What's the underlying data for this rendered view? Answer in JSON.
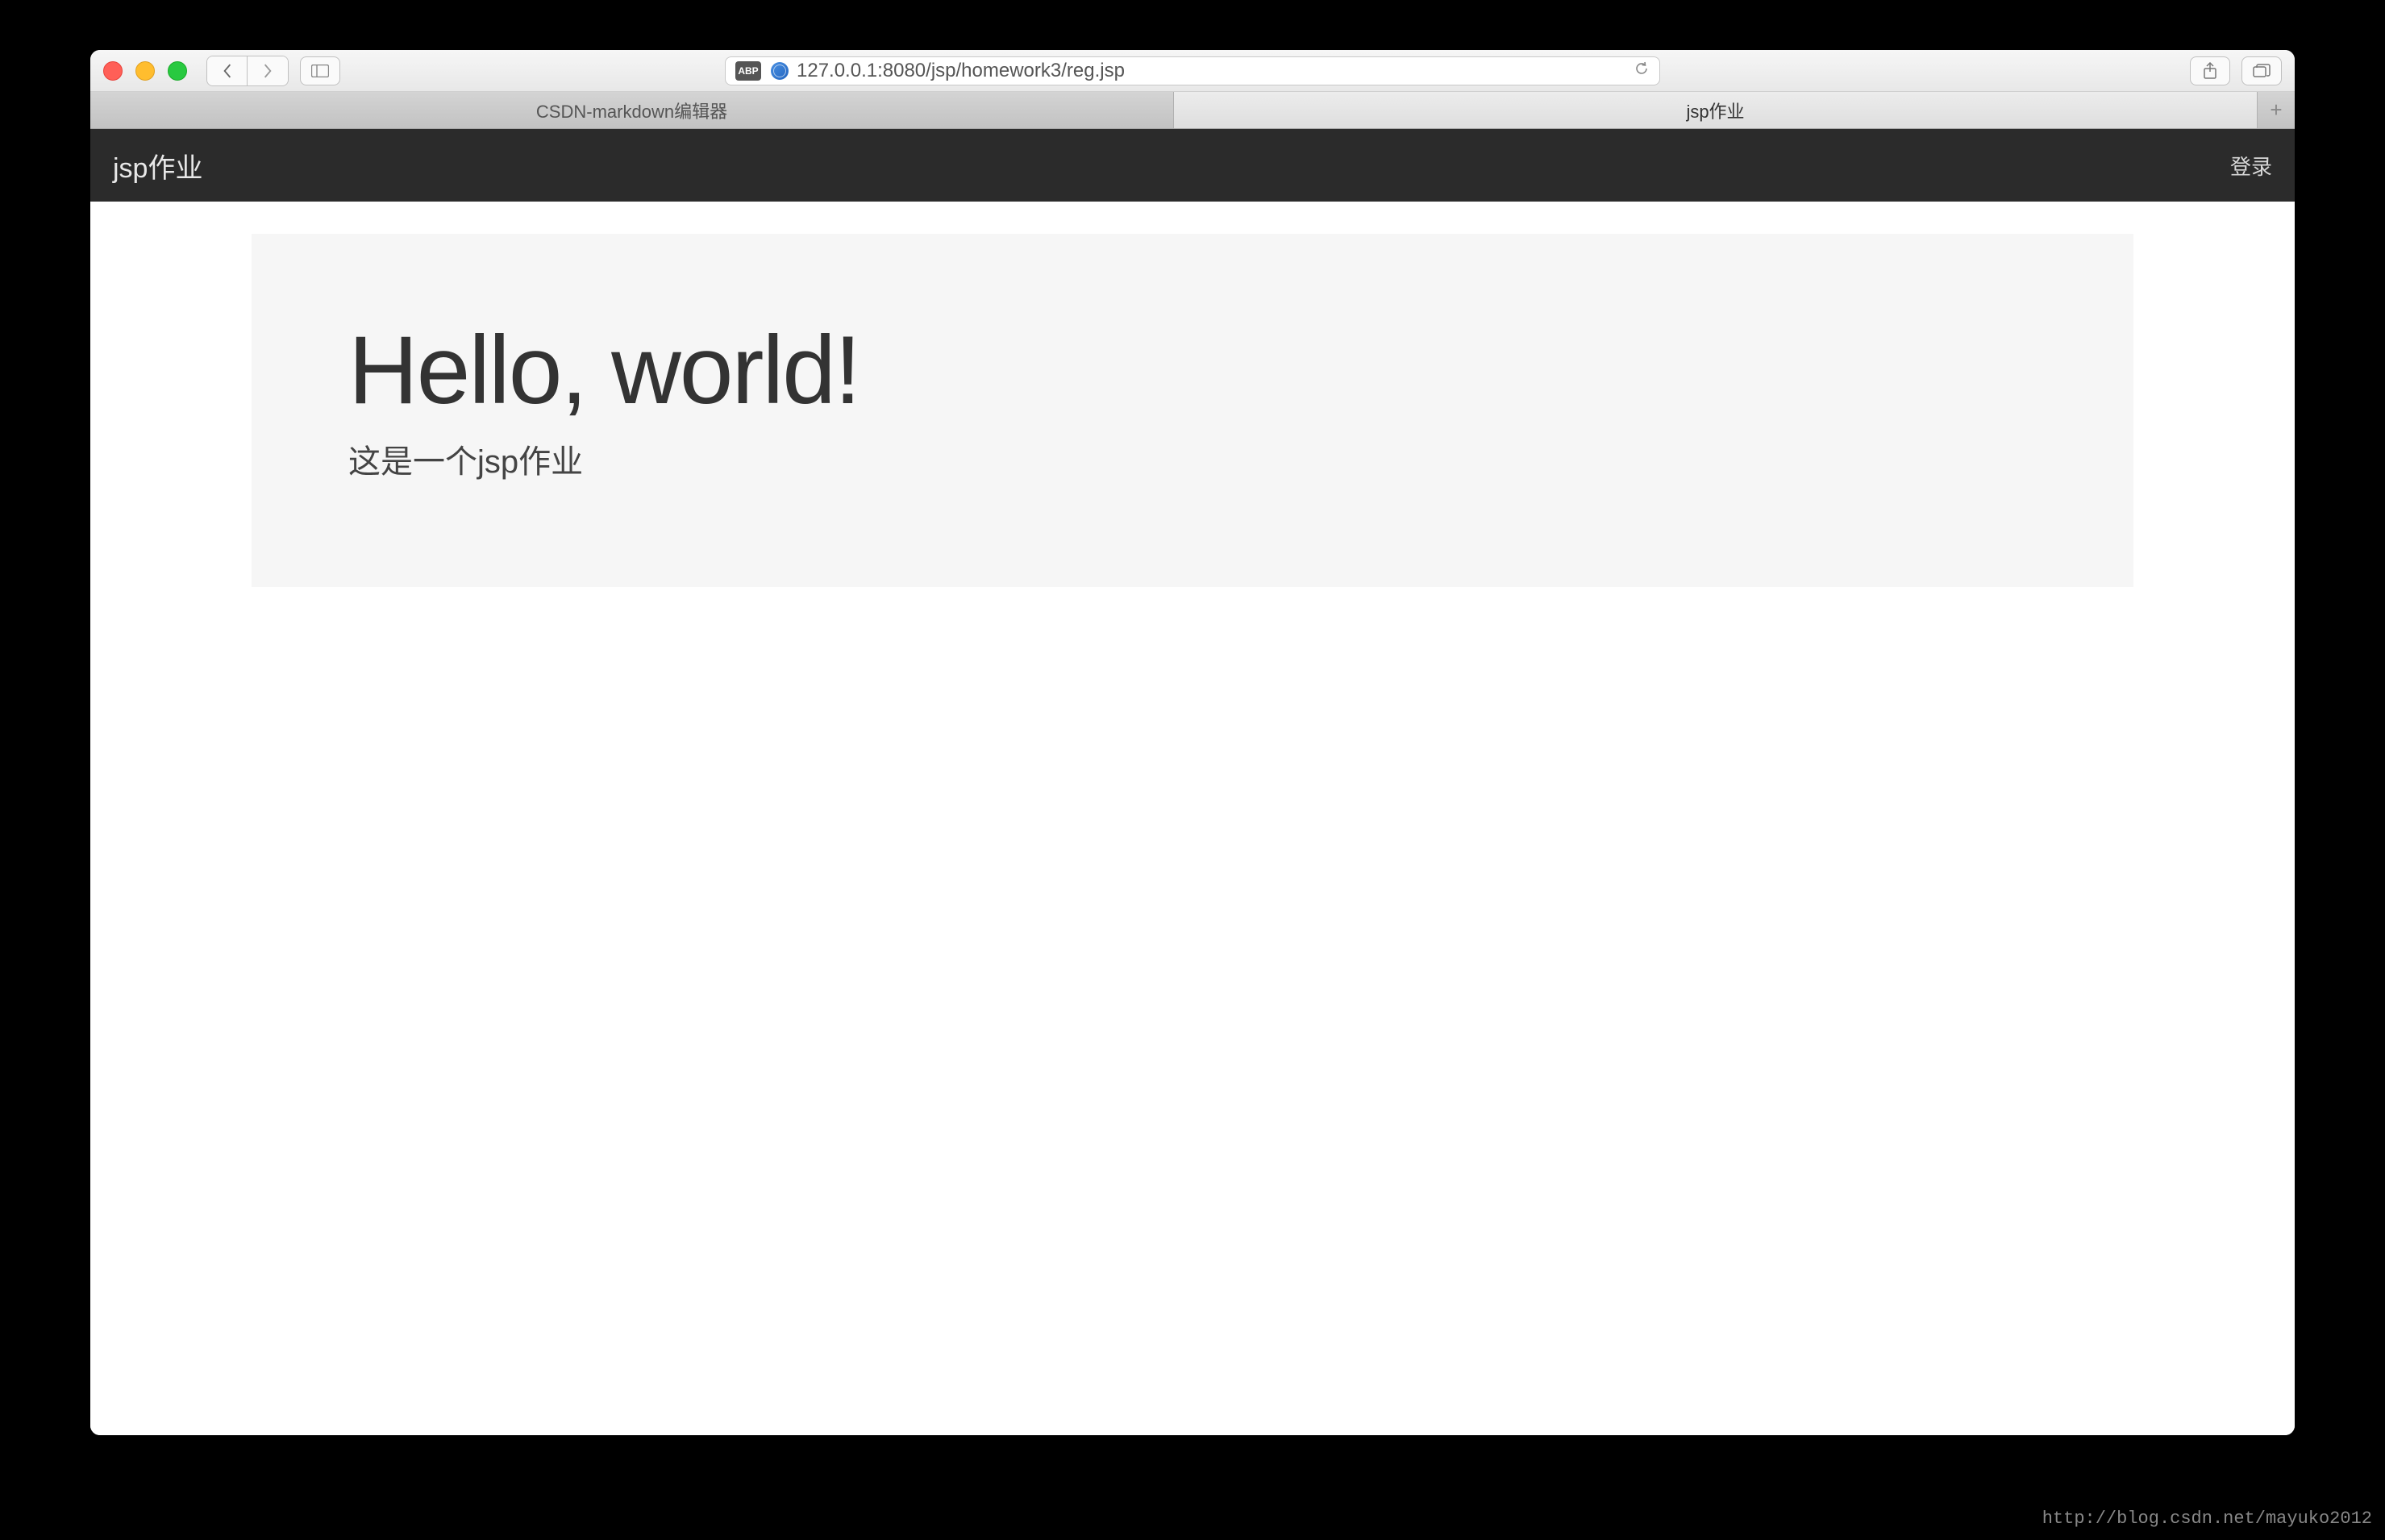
{
  "browser": {
    "url": "127.0.0.1:8080/jsp/homework3/reg.jsp",
    "abp_label": "ABP",
    "tabs": [
      {
        "label": "CSDN-markdown编辑器",
        "active": false
      },
      {
        "label": "jsp作业",
        "active": true
      }
    ]
  },
  "page": {
    "navbar": {
      "brand": "jsp作业",
      "login": "登录"
    },
    "jumbotron": {
      "title": "Hello, world!",
      "subtitle": "这是一个jsp作业"
    }
  },
  "watermark": "http://blog.csdn.net/mayuko2012"
}
